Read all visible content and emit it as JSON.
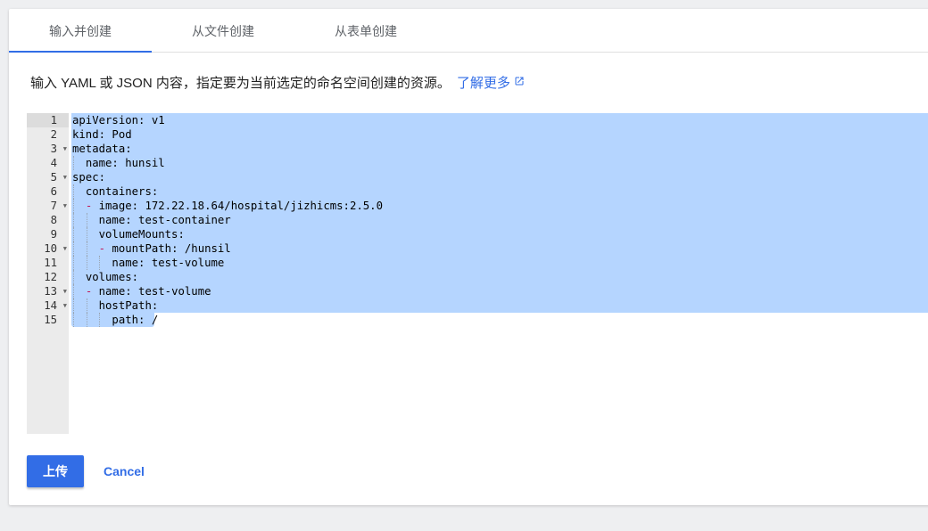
{
  "tabs": [
    {
      "label": "输入并创建",
      "active": true
    },
    {
      "label": "从文件创建",
      "active": false
    },
    {
      "label": "从表单创建",
      "active": false
    }
  ],
  "description": {
    "text": "输入 YAML 或 JSON 内容，指定要为当前选定的命名空间创建的资源。",
    "link": "了解更多",
    "link_icon": "open-in-new-icon"
  },
  "editor": {
    "lines": [
      {
        "n": "1",
        "indent": 0,
        "dash": false,
        "key": "apiVersion",
        "value": "v1",
        "fold": false
      },
      {
        "n": "2",
        "indent": 0,
        "dash": false,
        "key": "kind",
        "value": "Pod",
        "fold": false
      },
      {
        "n": "3",
        "indent": 0,
        "dash": false,
        "key": "metadata",
        "value": "",
        "fold": true
      },
      {
        "n": "4",
        "indent": 1,
        "dash": false,
        "key": "name",
        "value": "hunsil",
        "fold": false
      },
      {
        "n": "5",
        "indent": 0,
        "dash": false,
        "key": "spec",
        "value": "",
        "fold": true
      },
      {
        "n": "6",
        "indent": 1,
        "dash": false,
        "key": "containers",
        "value": "",
        "fold": false
      },
      {
        "n": "7",
        "indent": 1,
        "dash": true,
        "key": "image",
        "value": "172.22.18.64/hospital/jizhicms:2.5.0",
        "fold": true
      },
      {
        "n": "8",
        "indent": 2,
        "dash": false,
        "key": "name",
        "value": "test-container",
        "fold": false
      },
      {
        "n": "9",
        "indent": 2,
        "dash": false,
        "key": "volumeMounts",
        "value": "",
        "fold": false
      },
      {
        "n": "10",
        "indent": 2,
        "dash": true,
        "key": "mountPath",
        "value": "/hunsil",
        "fold": true
      },
      {
        "n": "11",
        "indent": 3,
        "dash": false,
        "key": "name",
        "value": "test-volume",
        "fold": false
      },
      {
        "n": "12",
        "indent": 1,
        "dash": false,
        "key": "volumes",
        "value": "",
        "fold": false
      },
      {
        "n": "13",
        "indent": 1,
        "dash": true,
        "key": "name",
        "value": "test-volume",
        "fold": true
      },
      {
        "n": "14",
        "indent": 2,
        "dash": false,
        "key": "hostPath",
        "value": "",
        "fold": true
      },
      {
        "n": "15",
        "indent": 3,
        "dash": false,
        "key": "path",
        "value": "/",
        "fold": false
      }
    ]
  },
  "actions": {
    "upload_label": "上传",
    "cancel_label": "Cancel"
  },
  "colors": {
    "accent": "#326de6",
    "selection": "#b5d5ff",
    "yaml_dash": "#c2185b",
    "gutter": "#ebebeb"
  }
}
